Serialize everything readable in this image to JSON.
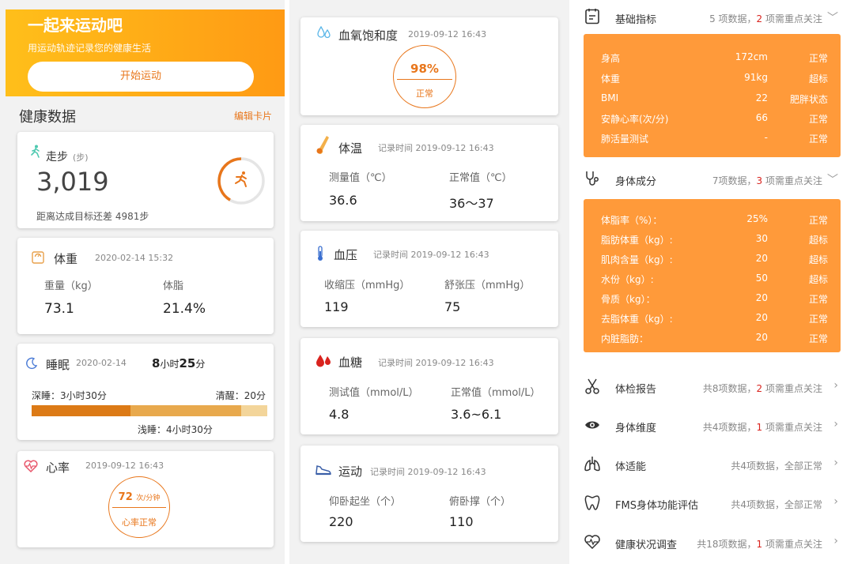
{
  "banner": {
    "title": "一起来运动吧",
    "subtitle": "用运动轨迹记录您的健康生活",
    "button": "开始运动"
  },
  "health": {
    "title": "健康数据",
    "edit": "编辑卡片"
  },
  "steps": {
    "label": "走步",
    "unit": "(步)",
    "value": "3,019",
    "remain": "距离达成目标还差 4981步"
  },
  "weight": {
    "label": "体重",
    "time": "2020-02-14 15:32",
    "m1_label": "重量（kg）",
    "m1_value": "73.1",
    "m2_label": "体脂",
    "m2_value": "21.4%"
  },
  "sleep": {
    "label": "睡眠",
    "date": "2020-02-14",
    "dur_h": "8",
    "dur_h_unit": "小时",
    "dur_m": "25",
    "dur_m_unit": "分",
    "deep": "深睡：3小时30分",
    "awake": "清醒：20分",
    "light": "浅睡：4小时30分",
    "deep_fraction": 0.42,
    "light_fraction": 0.47,
    "awake_fraction": 0.11
  },
  "heart": {
    "label": "心率",
    "time": "2019-09-12 16:43",
    "value": "72",
    "unit": "次/分钟",
    "status": "心率正常"
  },
  "spo2": {
    "label": "血氧饱和度",
    "time": "2019-09-12 16:43",
    "value": "98%",
    "status": "正常"
  },
  "temp": {
    "label": "体温",
    "time": "记录时间 2019-09-12 16:43",
    "m1_label": "测量值（℃）",
    "m1_value": "36.6",
    "m2_label": "正常值（℃）",
    "m2_value": "36～37"
  },
  "bp": {
    "label": "血压",
    "time": "记录时间 2019-09-12 16:43",
    "m1_label": "收缩压（mmHg）",
    "m1_value": "119",
    "m2_label": "舒张压（mmHg）",
    "m2_value": "75"
  },
  "glucose": {
    "label": "血糖",
    "time": "记录时间 2019-09-12 16:43",
    "m1_label": "测试值（mmol/L）",
    "m1_value": "4.8",
    "m2_label": "正常值（mmol/L）",
    "m2_value": "3.6~6.1"
  },
  "sport": {
    "label": "运动",
    "time": "记录时间 2019-09-12 16:43",
    "m1_label": "仰卧起坐（个）",
    "m1_value": "220",
    "m2_label": "俯卧撑（个）",
    "m2_value": "110"
  },
  "basic": {
    "title": "基础指标",
    "sum_pre": "5 项数据，",
    "sum_red": "2",
    "sum_post": " 项需重点关注",
    "rows": [
      {
        "k": "身高",
        "v": "172cm",
        "s": "正常"
      },
      {
        "k": "体重",
        "v": "91kg",
        "s": "超标"
      },
      {
        "k": "BMI",
        "v": "22",
        "s": "肥胖状态"
      },
      {
        "k": "安静心率(次/分)",
        "v": "66",
        "s": "正常"
      },
      {
        "k": "肺活量测试",
        "v": "-",
        "s": "正常"
      }
    ]
  },
  "body": {
    "title": "身体成分",
    "sum_pre": "7项数据，",
    "sum_red": "3",
    "sum_post": " 项需重点关注",
    "rows": [
      {
        "k": "体脂率（%）：",
        "v": "25%",
        "s": "正常"
      },
      {
        "k": "脂肪体重（kg）:",
        "v": "30",
        "s": "超标"
      },
      {
        "k": "肌肉含量（kg）:",
        "v": "20",
        "s": "超标"
      },
      {
        "k": "水份（kg）:",
        "v": "50",
        "s": "超标"
      },
      {
        "k": "骨质（kg）：",
        "v": "20",
        "s": "正常"
      },
      {
        "k": "去脂体重（kg）:",
        "v": "20",
        "s": "正常"
      },
      {
        "k": "内脏脂肪：",
        "v": "20",
        "s": "正常"
      }
    ]
  },
  "reports": [
    {
      "title": "体检报告",
      "pre": "共8项数据，",
      "red": "2",
      "post": " 项需重点关注"
    },
    {
      "title": "身体维度",
      "pre": "共4项数据，",
      "red": "1",
      "post": " 项需重点关注"
    },
    {
      "title": "体适能",
      "pre": "共4项数据，全部正常",
      "red": "",
      "post": ""
    },
    {
      "title": "FMS身体功能评估",
      "pre": "共4项数据，全部正常",
      "red": "",
      "post": ""
    },
    {
      "title": "健康状况调查",
      "pre": "共18项数据，",
      "red": "1",
      "post": " 项需重点关注"
    }
  ],
  "colors": {
    "accent": "#e8761b",
    "orange_box": "#ff9a3a",
    "red": "#d9231e",
    "deep_sleep": "#dc7a16",
    "light_sleep": "#e8a94d",
    "awake": "#f3d59a"
  }
}
